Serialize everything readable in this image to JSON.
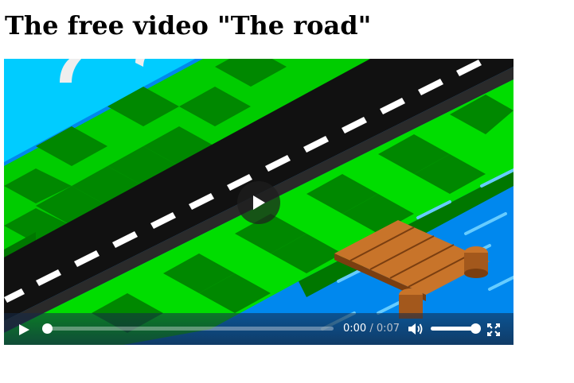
{
  "page": {
    "title": "The free video \"The road\""
  },
  "video": {
    "scene": "isometric-road-grass-river-pier",
    "colors": {
      "sky": "#00ccff",
      "grass_light": "#00dd00",
      "grass_dark": "#008800",
      "road": "#111111",
      "road_marking": "#ffffff",
      "water": "#0088ee",
      "water_streak": "#66ccff",
      "pier_wood": "#b5651d",
      "control_bar": "#14284a"
    },
    "controls": {
      "play_icon": "play-icon",
      "big_play_icon": "play-icon",
      "current_time": "0:00",
      "separator": " / ",
      "duration": "0:07",
      "progress": 0.0,
      "volume_icon": "speaker-volume-icon",
      "volume": 1.0,
      "fullscreen_icon": "fullscreen-icon"
    }
  }
}
